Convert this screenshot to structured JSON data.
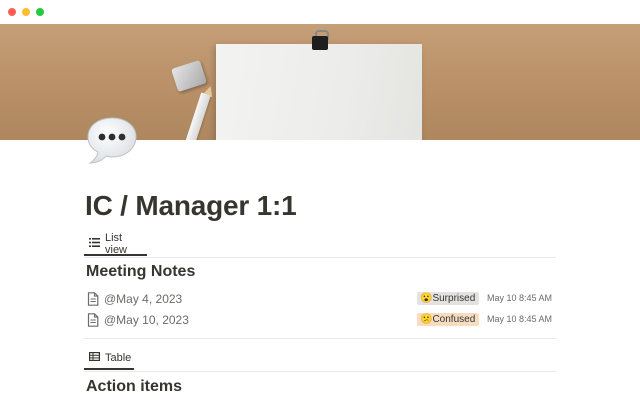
{
  "window": {
    "controls": [
      "close",
      "minimize",
      "zoom"
    ],
    "colors": {
      "close": "#ff5f57",
      "minimize": "#febc2e",
      "zoom": "#28c840"
    }
  },
  "page": {
    "icon": "speech-bubble-icon",
    "title": "IC / Manager 1:1"
  },
  "views": [
    {
      "label": "List view",
      "icon": "list-icon",
      "active": true
    },
    {
      "label": "Table",
      "icon": "table-icon",
      "active": false
    }
  ],
  "meeting_notes": {
    "title": "Meeting Notes",
    "rows": [
      {
        "icon": "document-icon",
        "date": "@May 4, 2023",
        "tag_emoji": "😮",
        "tag": "Surprised",
        "tag_color": "#e3e2e0",
        "time": "May 10 8:45 AM"
      },
      {
        "icon": "document-icon",
        "date": "@May 10, 2023",
        "tag_emoji": "😕",
        "tag": "Confused",
        "tag_color": "#f6ddc2",
        "time": "May 10 8:45 AM"
      }
    ]
  },
  "action_items": {
    "title": "Action items"
  },
  "colors": {
    "text": "#37352f",
    "muted": "#6b6b68",
    "divider": "#e9e9e7"
  }
}
